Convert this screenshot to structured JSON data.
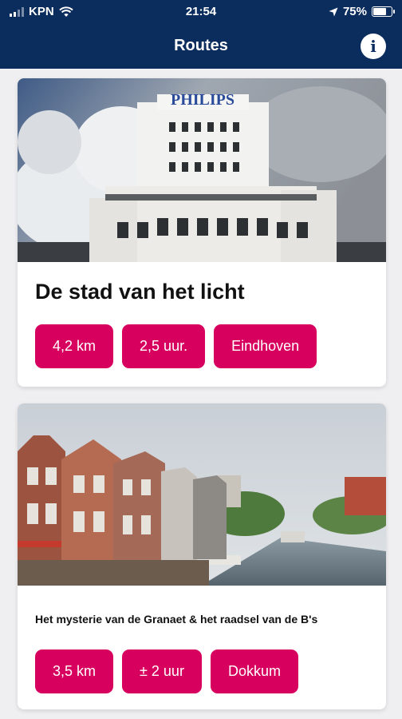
{
  "status_bar": {
    "carrier": "KPN",
    "time": "21:54",
    "battery_percent": "75%",
    "battery_level": 0.75,
    "icons": [
      "signal-icon",
      "wifi-icon",
      "location-arrow-icon",
      "battery-icon"
    ]
  },
  "header": {
    "title": "Routes",
    "info_icon": "info-icon",
    "info_glyph": "i",
    "background_color": "#0b2d5e"
  },
  "routes": [
    {
      "title": "De stad van het licht",
      "photo_sign": "PHILIPS",
      "tags": [
        "4,2 km",
        "2,5 uur.",
        "Eindhoven"
      ]
    },
    {
      "title": "Het mysterie van de Granaet & het raadsel van de B's",
      "tags": [
        "3,5 km",
        "± 2 uur",
        "Dokkum"
      ]
    }
  ],
  "colors": {
    "accent": "#d8005f",
    "card_background": "#ffffff",
    "page_background": "#efeff1"
  }
}
